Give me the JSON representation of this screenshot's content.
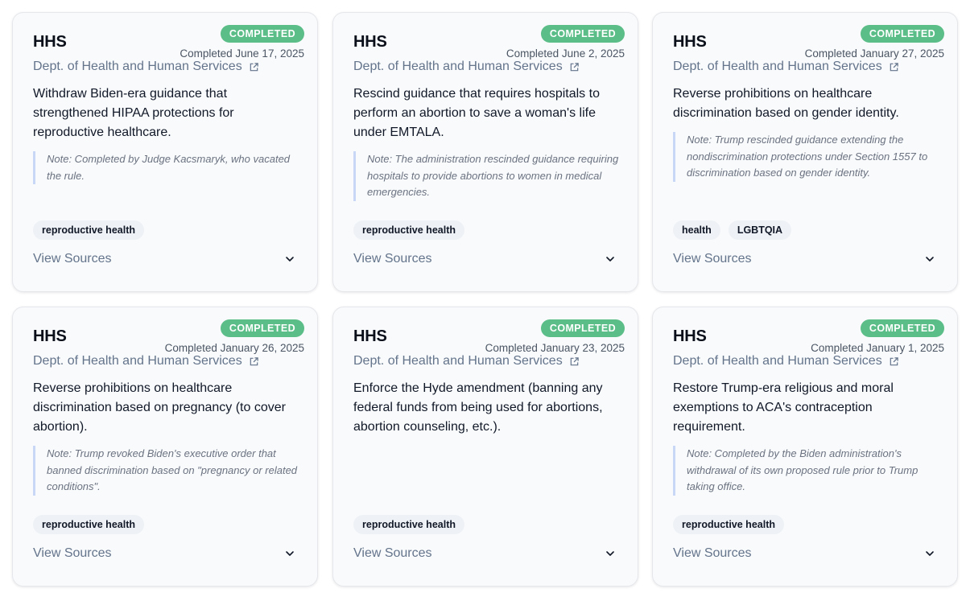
{
  "cards": [
    {
      "agency": "HHS",
      "status": "COMPLETED",
      "date": "Completed June 17, 2025",
      "department": "Dept. of Health and Human Services",
      "description": "Withdraw Biden-era guidance that strengthened HIPAA protections for reproductive healthcare.",
      "note": "Note: Completed by Judge Kacsmaryk, who vacated the rule.",
      "tags": [
        "reproductive health"
      ],
      "sources_label": "View Sources"
    },
    {
      "agency": "HHS",
      "status": "COMPLETED",
      "date": "Completed June 2, 2025",
      "department": "Dept. of Health and Human Services",
      "description": "Rescind guidance that requires hospitals to perform an abortion to save a woman's life under EMTALA.",
      "note": "Note: The administration rescinded guidance requiring hospitals to provide abortions to women in medical emergencies.",
      "tags": [
        "reproductive health"
      ],
      "sources_label": "View Sources"
    },
    {
      "agency": "HHS",
      "status": "COMPLETED",
      "date": "Completed January 27, 2025",
      "department": "Dept. of Health and Human Services",
      "description": "Reverse prohibitions on healthcare discrimination based on gender identity.",
      "note": "Note: Trump rescinded guidance extending the nondiscrimination protections under Section 1557 to discrimination based on gender identity.",
      "tags": [
        "health",
        "LGBTQIA"
      ],
      "sources_label": "View Sources"
    },
    {
      "agency": "HHS",
      "status": "COMPLETED",
      "date": "Completed January 26, 2025",
      "department": "Dept. of Health and Human Services",
      "description": "Reverse prohibitions on healthcare discrimination based on pregnancy (to cover abortion).",
      "note": "Note: Trump revoked Biden's executive order that banned discrimination based on \"pregnancy or related conditions\".",
      "tags": [
        "reproductive health"
      ],
      "sources_label": "View Sources"
    },
    {
      "agency": "HHS",
      "status": "COMPLETED",
      "date": "Completed January 23, 2025",
      "department": "Dept. of Health and Human Services",
      "description": "Enforce the Hyde amendment (banning any federal funds from being used for abortions, abortion counseling, etc.).",
      "note": "",
      "tags": [
        "reproductive health"
      ],
      "sources_label": "View Sources"
    },
    {
      "agency": "HHS",
      "status": "COMPLETED",
      "date": "Completed January 1, 2025",
      "department": "Dept. of Health and Human Services",
      "description": "Restore Trump-era religious and moral exemptions to ACA's contraception requirement.",
      "note": "Note: Completed by the Biden administration's withdrawal of its own proposed rule prior to Trump taking office.",
      "tags": [
        "reproductive health"
      ],
      "sources_label": "View Sources"
    }
  ],
  "colors": {
    "status_green": "#5bbd87",
    "note_border": "#c7d7f5",
    "muted_text": "#64748b",
    "card_bg": "#f8fafc"
  },
  "icons": {
    "department_link": "external-link-icon",
    "sources_toggle": "chevron-down-icon"
  }
}
